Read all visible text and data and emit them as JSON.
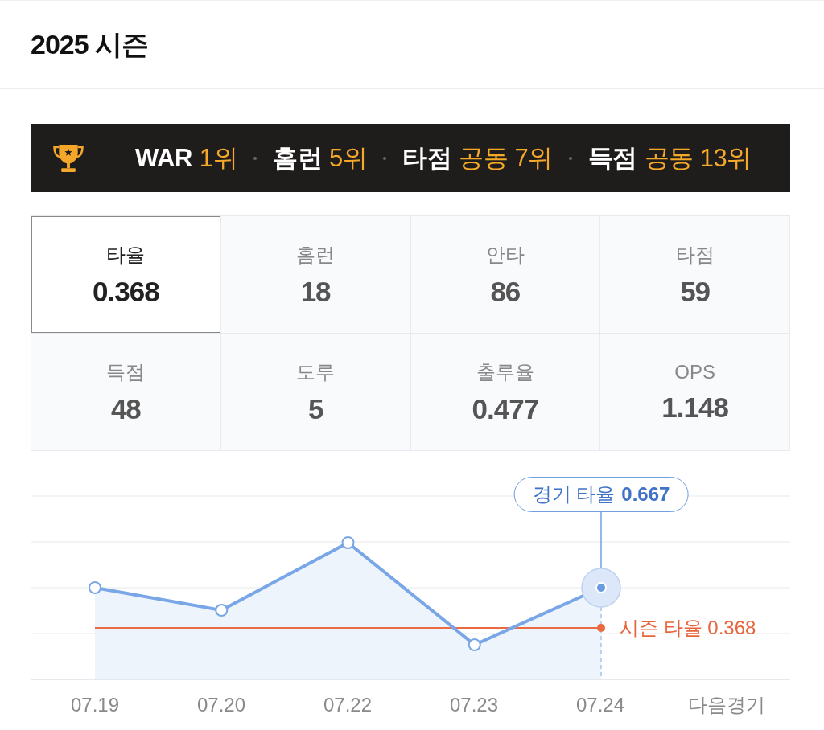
{
  "header": {
    "title": "2025 시즌"
  },
  "rankings": [
    {
      "category": "WAR",
      "rank": "1위"
    },
    {
      "category": "홈런",
      "rank": "5위"
    },
    {
      "category": "타점",
      "rank": "공동 7위"
    },
    {
      "category": "득점",
      "rank": "공동 13위"
    }
  ],
  "stats": [
    {
      "label": "타율",
      "value": "0.368",
      "selected": true
    },
    {
      "label": "홈런",
      "value": "18",
      "selected": false
    },
    {
      "label": "안타",
      "value": "86",
      "selected": false
    },
    {
      "label": "타점",
      "value": "59",
      "selected": false
    },
    {
      "label": "득점",
      "value": "48",
      "selected": false
    },
    {
      "label": "도루",
      "value": "5",
      "selected": false
    },
    {
      "label": "출루율",
      "value": "0.477",
      "selected": false
    },
    {
      "label": "OPS",
      "value": "1.148",
      "selected": false
    }
  ],
  "chart": {
    "tooltip": {
      "label": "경기 타율",
      "value": "0.667"
    },
    "season_average": "시즌 타율 0.368",
    "points": [
      {
        "date": "07.19",
        "selected": false
      },
      {
        "date": "07.20",
        "selected": false
      },
      {
        "date": "07.22",
        "selected": false
      },
      {
        "date": "07.23",
        "selected": false
      },
      {
        "date": "07.24",
        "selected": true
      }
    ],
    "next_label": "다음경기"
  }
}
